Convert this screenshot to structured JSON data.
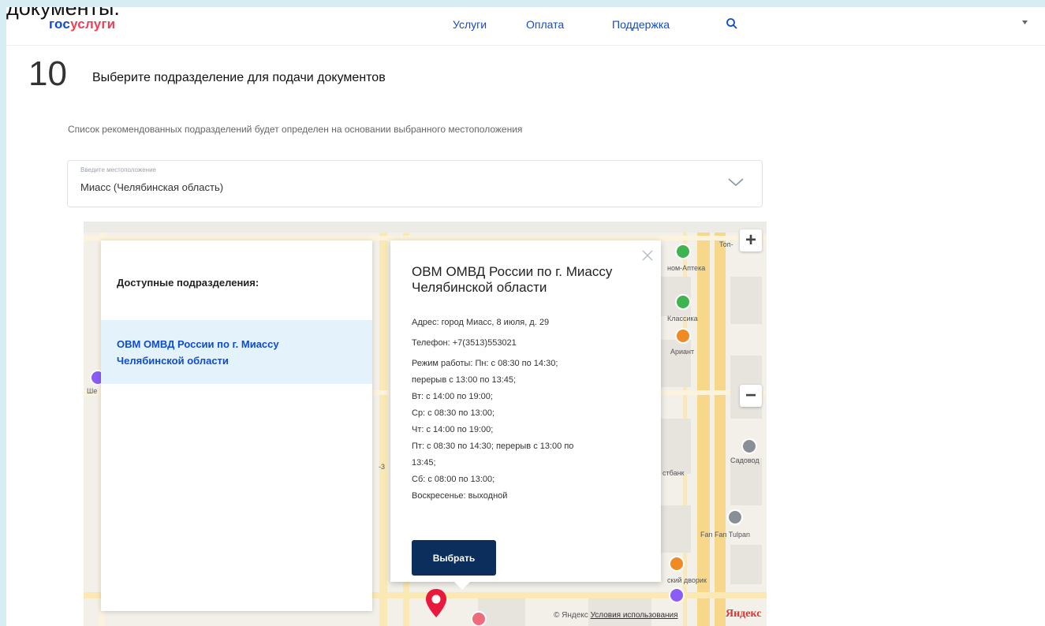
{
  "top_cut_text": "документы.",
  "header": {
    "logo_part1": "гос",
    "logo_part2": "услуги",
    "nav": [
      "Услуги",
      "Оплата",
      "Поддержка"
    ],
    "brand_blue": "#0d4cd3",
    "brand_red": "#ee3f58"
  },
  "step": {
    "number": "10",
    "title": "Выберите подразделение для подачи документов",
    "hint": "Список рекомендованных подразделений будет определен на основании выбранного местоположения"
  },
  "location": {
    "label": "Введите местоположение",
    "value": "Миасс (Челябинская область)"
  },
  "units_panel": {
    "title": "Доступные подразделения:",
    "items": [
      "ОВМ ОМВД России по г. Миассу Челябинской области"
    ]
  },
  "popup": {
    "title": "ОВМ ОМВД России по г. Миассу Челябинской области",
    "lines": [
      "Адрес: город Миасс, 8 июля, д. 29",
      "Телефон: +7(3513)553021",
      "Режим работы: Пн: с 08:30 по 14:30;",
      "перерыв с 13:00 по 13:45;",
      "Вт: с 14:00 по 19:00;",
      "Ср: с 08:30 по 13:00;",
      "Чт: с 14:00 по 19:00;",
      "Пт: с 08:30 по 14:30; перерыв с 13:00 по",
      "13:45;",
      "Сб: с 08:00 по 13:00;",
      "Воскресенье: выходной"
    ],
    "button_label": "Выбрать",
    "button_color": "#0b2e5c"
  },
  "map": {
    "zoom_in": "+",
    "zoom_out": "−",
    "poi_labels": [
      "Топ-",
      "ном-Аптека",
      "Классика",
      "Ариант",
      "Садовод",
      "стбанк",
      "Fan Fan Tulpan",
      "ский дворик",
      "Ше",
      "-3"
    ],
    "copyright": "© Яндекс",
    "terms": "Условия использования",
    "logo": "Яндекс",
    "pin_color": "#e8193c"
  }
}
